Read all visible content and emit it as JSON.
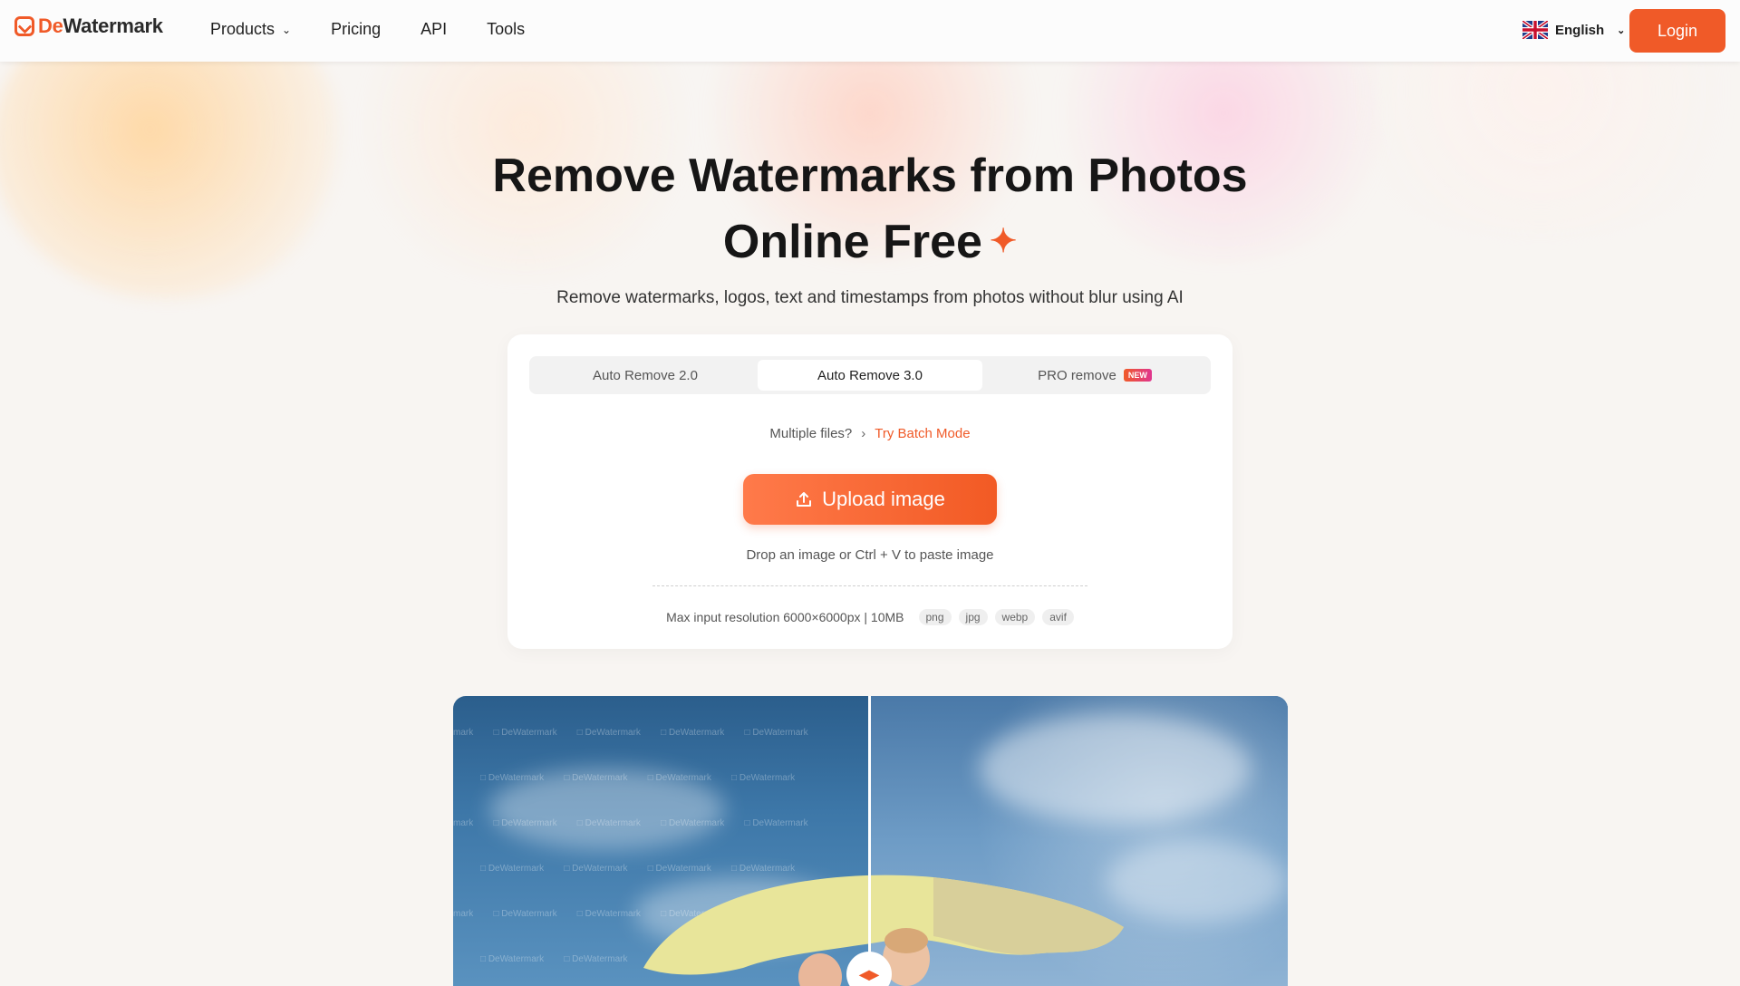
{
  "brand": {
    "name_prefix": "De",
    "name_suffix": "Watermark"
  },
  "nav": {
    "products": "Products",
    "pricing": "Pricing",
    "api": "API",
    "tools": "Tools"
  },
  "language": {
    "label": "English"
  },
  "login": {
    "label": "Login"
  },
  "hero": {
    "title_line1": "Remove Watermarks from Photos",
    "title_line2": "Online Free",
    "subtitle": "Remove watermarks, logos, text and timestamps from photos without blur using AI"
  },
  "tabs": [
    {
      "label": "Auto Remove 2.0",
      "active": false
    },
    {
      "label": "Auto Remove 3.0",
      "active": true
    },
    {
      "label": "PRO remove",
      "active": false,
      "badge": "NEW"
    }
  ],
  "batch": {
    "question": "Multiple files?",
    "link": "Try Batch Mode"
  },
  "upload": {
    "label": "Upload image",
    "hint": "Drop an image or Ctrl + V to paste image"
  },
  "limits": {
    "text": "Max input resolution 6000×6000px | 10MB",
    "formats": [
      "png",
      "jpg",
      "webp",
      "avif"
    ]
  },
  "colors": {
    "accent": "#f05a28",
    "badge_gradient_end": "#e0358f"
  },
  "icons": {
    "logo": "logo-icon",
    "upload": "upload-icon",
    "chevron": "chevron-down-icon",
    "flag": "uk-flag-icon",
    "sparkle": "sparkle-icon"
  }
}
